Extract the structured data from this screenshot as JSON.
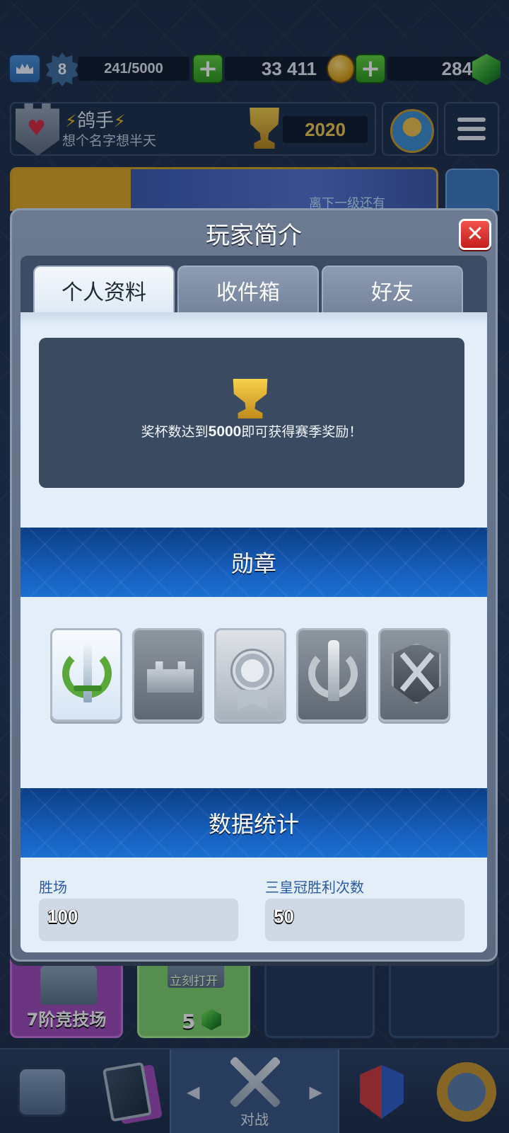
{
  "hud": {
    "level": "8",
    "xp": "241/5000",
    "gold": "33 411",
    "gems": "284"
  },
  "player": {
    "name": "鸽手",
    "clan": "想个名字想半天",
    "trophies": "2020"
  },
  "banner": {
    "text": "离下一级还有"
  },
  "chests": {
    "slot1_label": "7阶竞技场",
    "slot2_open": "立刻打开",
    "slot2_cost": "5"
  },
  "nav": {
    "battle_label": "对战"
  },
  "modal": {
    "title": "玩家简介",
    "tabs": [
      "个人资料",
      "收件箱",
      "好友"
    ],
    "trophy_msg_pre": "奖杯数达到",
    "trophy_msg_num": "5000",
    "trophy_msg_post": "即可获得赛季奖励！",
    "badges_title": "勋章",
    "stats_title": "数据统计",
    "stats": [
      {
        "label": "胜场",
        "value": "100"
      },
      {
        "label": "三皇冠胜利次数",
        "value": "50"
      }
    ]
  },
  "colors": {
    "accent_blue": "#1762c2",
    "close_red": "#c41d1d",
    "gold": "#f2c94c",
    "gem_green": "#2a9a2a"
  },
  "icons": [
    "king-level-icon",
    "level-star-icon",
    "plus-icon",
    "gold-coin-icon",
    "gem-icon",
    "clan-shield-icon",
    "trophy-icon",
    "arena-icon",
    "menu-icon",
    "close-icon",
    "chest-icon",
    "shop-icon",
    "cards-icon",
    "battle-swords-icon",
    "clan-icon",
    "events-icon",
    "badge-icons"
  ]
}
